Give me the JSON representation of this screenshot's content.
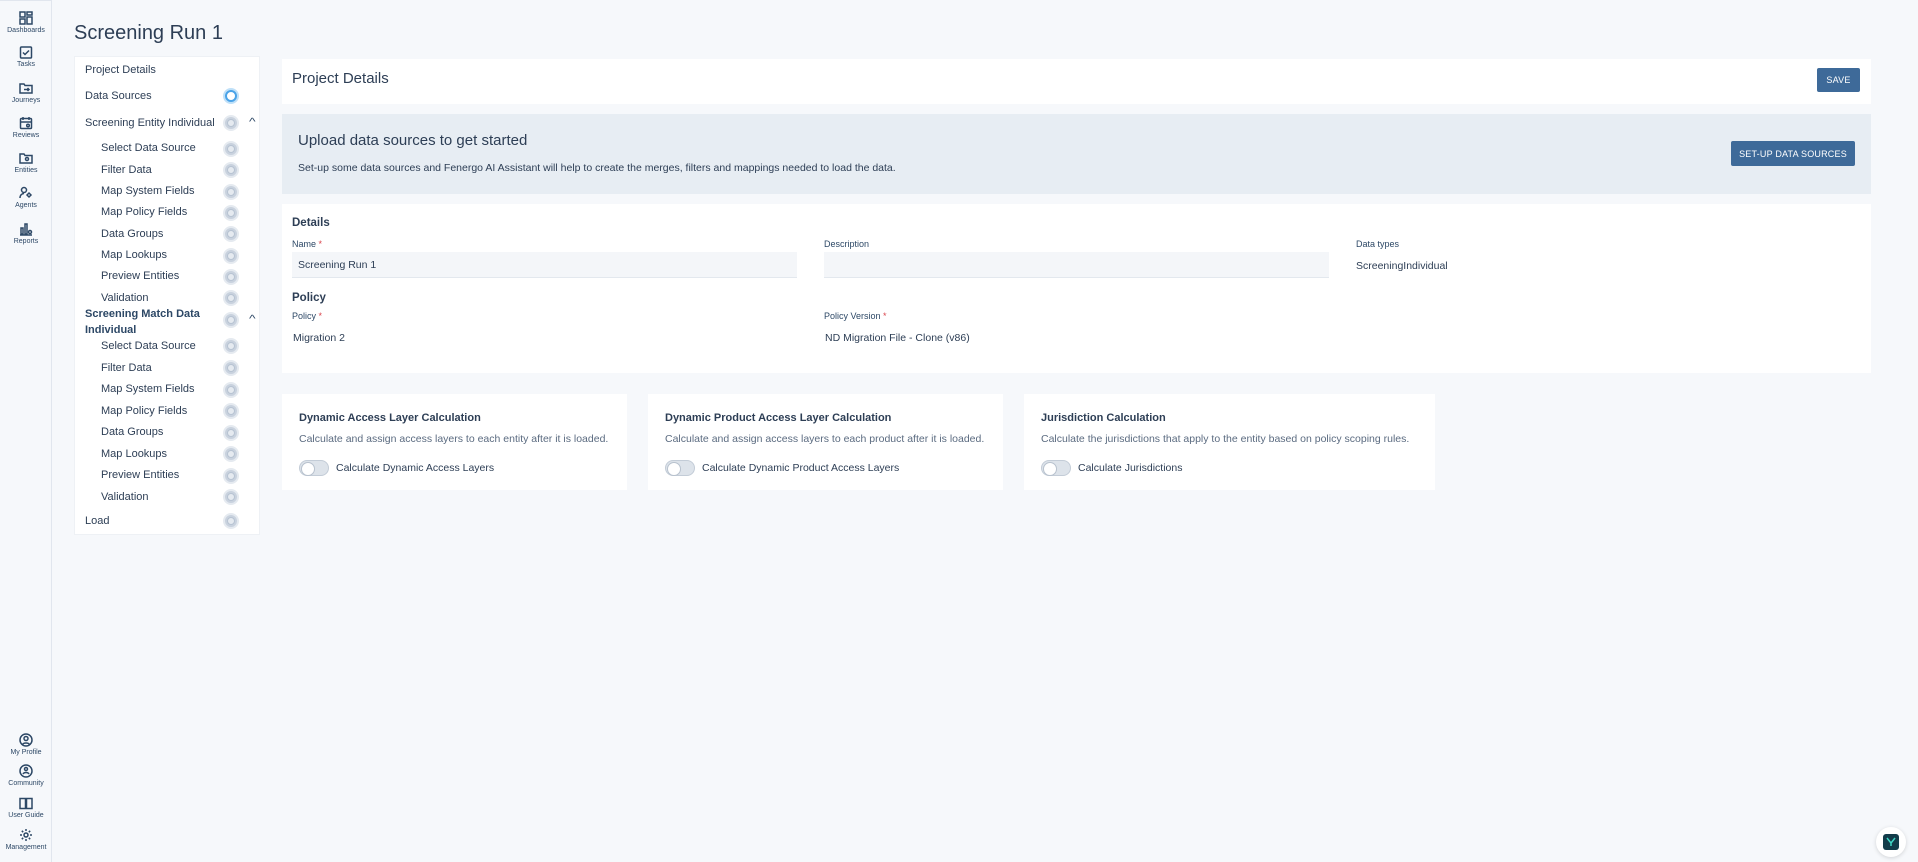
{
  "nav": {
    "top": [
      {
        "label": "Dashboards",
        "icon": "dashboard-icon"
      },
      {
        "label": "Tasks",
        "icon": "tasks-icon"
      },
      {
        "label": "Journeys",
        "icon": "journeys-icon"
      },
      {
        "label": "Reviews",
        "icon": "reviews-icon"
      },
      {
        "label": "Entities",
        "icon": "entities-icon"
      },
      {
        "label": "Agents",
        "icon": "agents-icon"
      },
      {
        "label": "Reports",
        "icon": "reports-icon"
      }
    ],
    "bottom": [
      {
        "label": "My Profile",
        "icon": "profile-icon"
      },
      {
        "label": "Community",
        "icon": "community-icon"
      },
      {
        "label": "User Guide",
        "icon": "user-guide-icon"
      },
      {
        "label": "Management",
        "icon": "gear-icon"
      }
    ]
  },
  "page": {
    "title": "Screening Run 1"
  },
  "steps": {
    "project_details": "Project Details",
    "data_sources": "Data Sources",
    "group1": {
      "label": "Screening Entity Individual",
      "items": [
        "Select Data Source",
        "Filter Data",
        "Map System Fields",
        "Map Policy Fields",
        "Data Groups",
        "Map Lookups",
        "Preview Entities",
        "Validation"
      ]
    },
    "group2": {
      "label": "Screening Match Data Individual",
      "items": [
        "Select Data Source",
        "Filter Data",
        "Map System Fields",
        "Map Policy Fields",
        "Data Groups",
        "Map Lookups",
        "Preview Entities",
        "Validation"
      ]
    },
    "load": "Load"
  },
  "header": {
    "title": "Project Details",
    "save_label": "SAVE"
  },
  "banner": {
    "title": "Upload data sources to get started",
    "text": "Set-up some data sources and Fenergo AI Assistant will help to create the merges, filters and mappings needed to load the data.",
    "button_label": "SET-UP DATA SOURCES"
  },
  "details": {
    "section_title": "Details",
    "name_label": "Name",
    "name_value": "Screening Run 1",
    "description_label": "Description",
    "description_value": "",
    "data_types_label": "Data types",
    "data_types_value": "ScreeningIndividual",
    "required_mark": "*"
  },
  "policy": {
    "section_title": "Policy",
    "policy_label": "Policy",
    "policy_value": "Migration 2",
    "version_label": "Policy Version",
    "version_value": "ND Migration File - Clone (v86)"
  },
  "calcs": [
    {
      "title": "Dynamic Access Layer Calculation",
      "desc": "Calculate and assign access layers to each entity after it is loaded.",
      "toggle_label": "Calculate Dynamic Access Layers",
      "enabled": false
    },
    {
      "title": "Dynamic Product Access Layer Calculation",
      "desc": "Calculate and assign access layers to each product after it is loaded.",
      "toggle_label": "Calculate Dynamic Product Access Layers",
      "enabled": false
    },
    {
      "title": "Jurisdiction Calculation",
      "desc": "Calculate the jurisdictions that apply to the entity based on policy scoping rules.",
      "toggle_label": "Calculate Jurisdictions",
      "enabled": false
    }
  ]
}
